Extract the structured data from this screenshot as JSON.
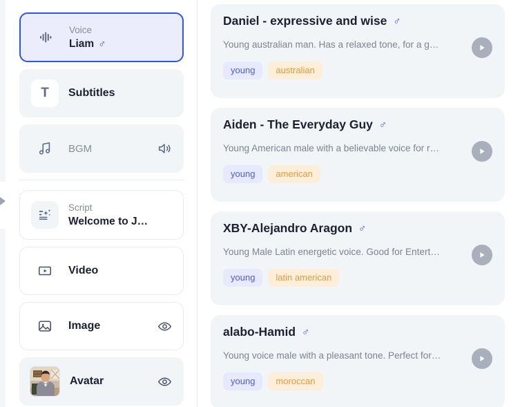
{
  "sidebar": {
    "items": [
      {
        "name": "voice",
        "icon": "waveform-icon",
        "sub_label": "Voice",
        "title": "Liam",
        "gender": "♂",
        "state": "selected"
      },
      {
        "name": "subtitles",
        "icon": "text-t-icon",
        "label": "Subtitles",
        "state": "muted"
      },
      {
        "name": "bgm",
        "icon": "music-note-icon",
        "label": "BGM",
        "trailing_icon": "speaker-icon",
        "state": "muted"
      },
      {
        "name": "script",
        "icon": "magic-text-icon",
        "sub_label": "Script",
        "title": "Welcome to J…",
        "state": "plain"
      },
      {
        "name": "video",
        "icon": "video-frame-icon",
        "label": "Video",
        "state": "plain"
      },
      {
        "name": "image",
        "icon": "image-icon",
        "label": "Image",
        "trailing_icon": "eye-icon",
        "state": "plain"
      },
      {
        "name": "avatar",
        "icon": "avatar-thumbnail",
        "label": "Avatar",
        "trailing_icon": "eye-icon",
        "state": "muted"
      }
    ],
    "collapse_handle": "collapse-chevron-icon"
  },
  "voice_list": {
    "cards": [
      {
        "name": "Daniel - expressive and wise",
        "gender": "♂",
        "description": "Young australian man. Has a relaxed tone, for a g…",
        "tags": [
          {
            "label": "young",
            "color": "blue"
          },
          {
            "label": "australian",
            "color": "orange"
          }
        ],
        "play": "play-icon"
      },
      {
        "name": "Aiden - The Everyday Guy",
        "gender": "♂",
        "description": "Young American male with a believable voice for r…",
        "tags": [
          {
            "label": "young",
            "color": "blue"
          },
          {
            "label": "american",
            "color": "orange"
          }
        ],
        "play": "play-icon"
      },
      {
        "name": "XBY-Alejandro Aragon",
        "gender": "♂",
        "description": "Young Male Latin energetic voice. Good for Entert…",
        "tags": [
          {
            "label": "young",
            "color": "blue"
          },
          {
            "label": "latin american",
            "color": "orange"
          }
        ],
        "play": "play-icon"
      },
      {
        "name": "alabo-Hamid",
        "gender": "♂",
        "description": "Young voice male with a pleasant tone. Perfect for…",
        "tags": [
          {
            "label": "young",
            "color": "blue"
          },
          {
            "label": "moroccan",
            "color": "orange"
          }
        ],
        "play": "play-icon"
      }
    ]
  },
  "colors": {
    "accent": "#2f54eb",
    "selected_bg": "#ebedfd",
    "card_bg": "#f1f5f8",
    "tag_blue_bg": "#e7e9fc",
    "tag_blue_fg": "#4c5fd7",
    "tag_orange_bg": "#fdeed9",
    "tag_orange_fg": "#e59a3c",
    "play_btn": "#a9b0bb"
  }
}
